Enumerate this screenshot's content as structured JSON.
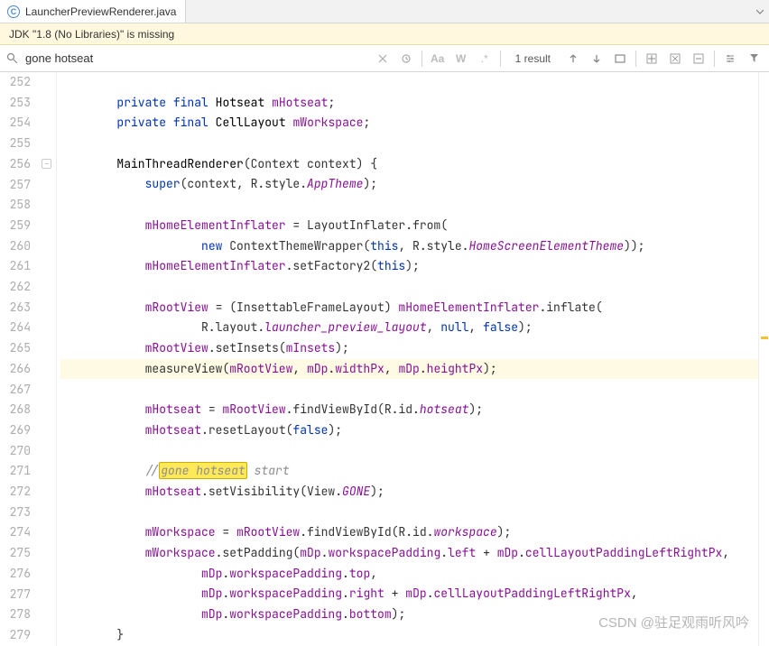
{
  "tab": {
    "filename": "LauncherPreviewRenderer.java",
    "iconLetter": "C"
  },
  "notice": "JDK \"1.8 (No Libraries)\" is missing",
  "search": {
    "query": "gone hotseat",
    "resultCount": "1 result",
    "matchCaseLabel": "Aa",
    "wordsLabel": "W",
    "regexLabel": ".*"
  },
  "lineStart": 252,
  "lineEnd": 279,
  "highlightedLine": 266,
  "foldAtLine": 256,
  "searchHitLine": 271,
  "watermark": "CSDN @驻足观雨听风吟",
  "code": {
    "l252": "",
    "l253_indent": "        ",
    "l253_kw1": "private",
    "l253_kw2": "final",
    "l253_type": "Hotseat",
    "l253_field": "mHotseat",
    "l254_kw1": "private",
    "l254_kw2": "final",
    "l254_type": "CellLayout",
    "l254_field": "mWorkspace",
    "l256_indent": "        ",
    "l256_method": "MainThreadRenderer",
    "l256_param": "Context context",
    "l257_indent": "            ",
    "l257_super": "super",
    "l257_args1": "context, R.style.",
    "l257_static": "AppTheme",
    "l259_indent": "            ",
    "l259_field": "mHomeElementInflater",
    "l259_eq": " = LayoutInflater.from(",
    "l260_indent": "                    ",
    "l260_new": "new",
    "l260_type": "ContextThemeWrapper",
    "l260_this": "this",
    "l260_rest": ", R.style.",
    "l260_static": "HomeScreenElementTheme",
    "l261_field": "mHomeElementInflater",
    "l261_rest": ".setFactory2(",
    "l261_this": "this",
    "l263_field": "mRootView",
    "l263_rest": " = (InsettableFrameLayout) ",
    "l263_field2": "mHomeElementInflater",
    "l263_rest2": ".inflate(",
    "l264_indent": "                    ",
    "l264_rest": "R.layout.",
    "l264_static": "launcher_preview_layout",
    "l264_rest2": ", ",
    "l264_null": "null",
    "l264_rest3": ", ",
    "l264_false": "false",
    "l265_field": "mRootView",
    "l265_rest": ".setInsets(",
    "l265_field2": "mInsets",
    "l266_rest": "measureView(",
    "l266_field": "mRootView",
    "l266_rest2": ", ",
    "l266_field2": "mDp",
    "l266_rest3": ".",
    "l266_field3": "widthPx",
    "l266_rest4": ", ",
    "l266_field4": "mDp",
    "l266_rest5": ".",
    "l266_field5": "heightPx",
    "l268_field": "mHotseat",
    "l268_rest": " = ",
    "l268_field2": "mRootView",
    "l268_rest2": ".findViewById(R.id.",
    "l268_static": "hotseat",
    "l269_field": "mHotseat",
    "l269_rest": ".resetLayout(",
    "l269_false": "false",
    "l271_comment_pre": "//",
    "l271_hit": "gone hotseat",
    "l271_comment_post": " start",
    "l272_field": "mHotseat",
    "l272_rest": ".setVisibility(View.",
    "l272_static": "GONE",
    "l274_field": "mWorkspace",
    "l274_rest": " = ",
    "l274_field2": "mRootView",
    "l274_rest2": ".findViewById(R.id.",
    "l274_static": "workspace",
    "l275_field": "mWorkspace",
    "l275_rest": ".setPadding(",
    "l275_field2": "mDp",
    "l275_d": ".",
    "l275_field3": "workspacePadding",
    "l275_d2": ".",
    "l275_field4": "left",
    "l275_plus": " + ",
    "l275_field5": "mDp",
    "l275_d3": ".",
    "l275_field6": "cellLayoutPaddingLeftRightPx",
    "l276_indent": "                    ",
    "l276_field": "mDp",
    "l276_d": ".",
    "l276_field2": "workspacePadding",
    "l276_d2": ".",
    "l276_field3": "top",
    "l277_field": "mDp",
    "l277_d": ".",
    "l277_field2": "workspacePadding",
    "l277_d2": ".",
    "l277_field3": "right",
    "l277_plus": " + ",
    "l277_field4": "mDp",
    "l277_d3": ".",
    "l277_field5": "cellLayoutPaddingLeftRightPx",
    "l278_field": "mDp",
    "l278_d": ".",
    "l278_field2": "workspacePadding",
    "l278_d2": ".",
    "l278_field3": "bottom",
    "l279_indent": "        ",
    "l279_brace": "}"
  }
}
